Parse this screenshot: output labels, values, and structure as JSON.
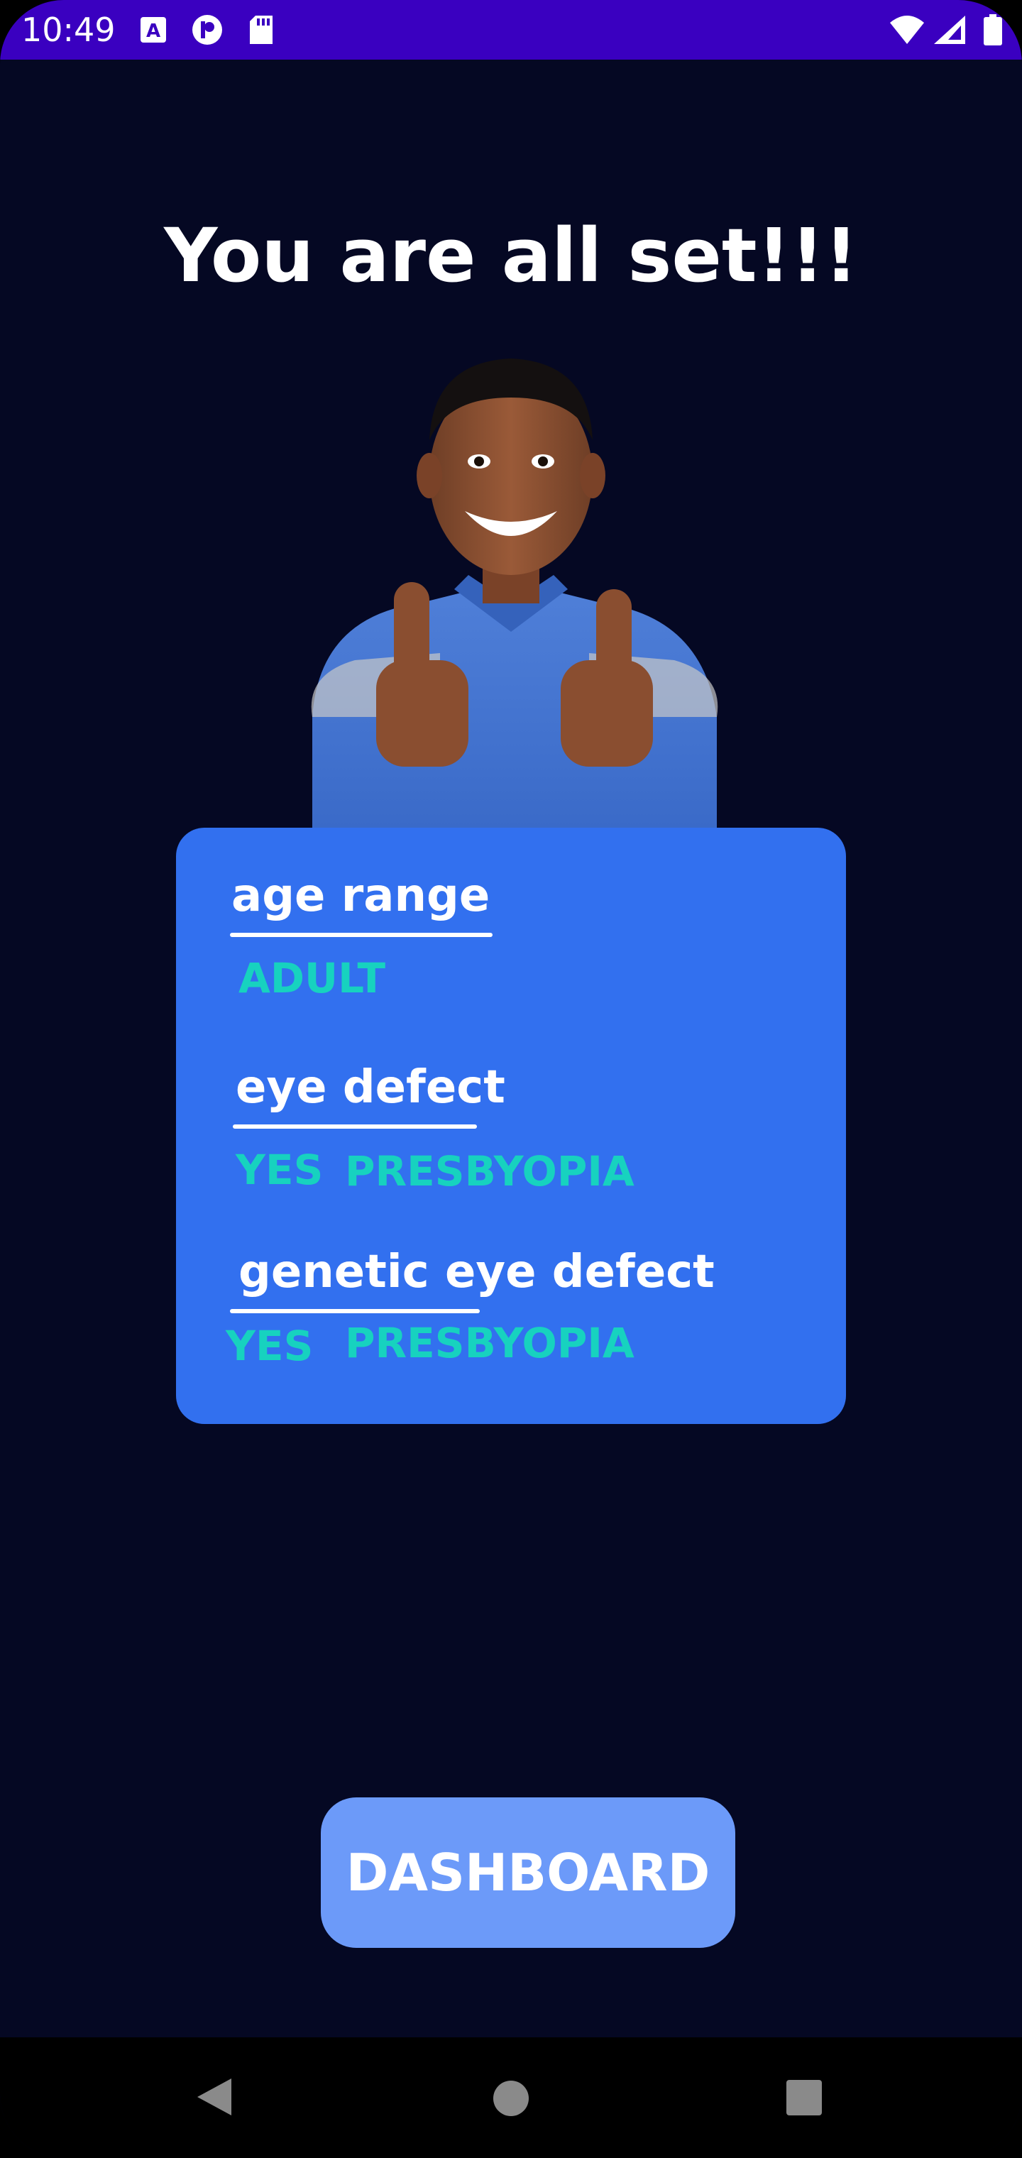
{
  "status_bar": {
    "time": "10:49",
    "icons": [
      "text-a-icon",
      "p-app-icon",
      "sd-card-icon",
      "wifi-icon",
      "signal-icon",
      "battery-icon"
    ],
    "color": "#3a00c0"
  },
  "headline": "You are all set!!!",
  "card": {
    "color": "#3270ef",
    "value_color": "#17d2bf",
    "sections": [
      {
        "label": "age range",
        "values": [
          "ADULT"
        ]
      },
      {
        "label": "eye defect",
        "values": [
          "YES",
          "PRESBYOPIA"
        ]
      },
      {
        "label": "genetic eye defect",
        "values": [
          "YES",
          "PRESBYOPIA"
        ]
      }
    ]
  },
  "dashboard_button": {
    "label": "DASHBOARD",
    "color": "#6c9af9"
  },
  "nav_bar": {
    "icons": [
      "back-icon",
      "home-icon",
      "recents-icon"
    ]
  },
  "background_color": "#050823"
}
